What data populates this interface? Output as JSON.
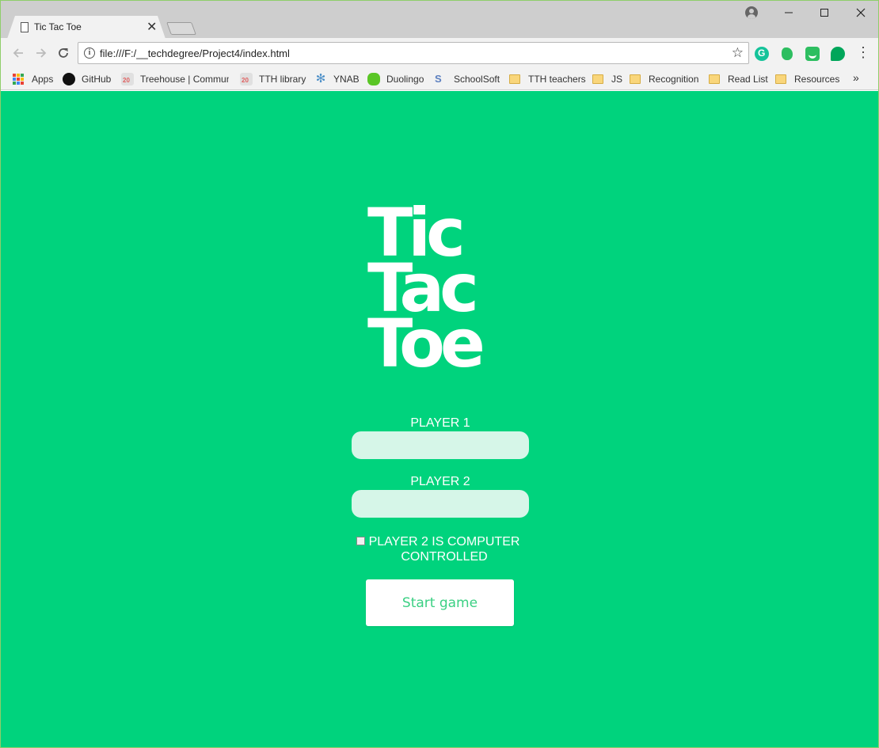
{
  "browser": {
    "tab_title": "Tic Tac Toe",
    "url": "file:///F:/__techdegree/Project4/index.html",
    "bookmarks": [
      {
        "label": "Apps"
      },
      {
        "label": "GitHub"
      },
      {
        "label": "Treehouse | Commun"
      },
      {
        "label": "TTH library"
      },
      {
        "label": "YNAB"
      },
      {
        "label": "Duolingo"
      },
      {
        "label": "SchoolSoft"
      },
      {
        "label": "TTH teachers"
      },
      {
        "label": "JS"
      },
      {
        "label": "Recognition"
      },
      {
        "label": "Read List"
      },
      {
        "label": "Resources"
      }
    ],
    "more_bookmarks": "»"
  },
  "game": {
    "title_lines": [
      "Tic",
      "Tac",
      "Toe"
    ],
    "player1_label": "PLAYER 1",
    "player1_value": "",
    "player2_label": "PLAYER 2",
    "player2_value": "",
    "computer_checkbox_label": "PLAYER 2 IS COMPUTER CONTROLLED",
    "computer_checked": false,
    "start_button": "Start game"
  },
  "colors": {
    "page_background": "#00d37d",
    "input_background": "#d6f6e8",
    "button_text": "#3bd083"
  }
}
